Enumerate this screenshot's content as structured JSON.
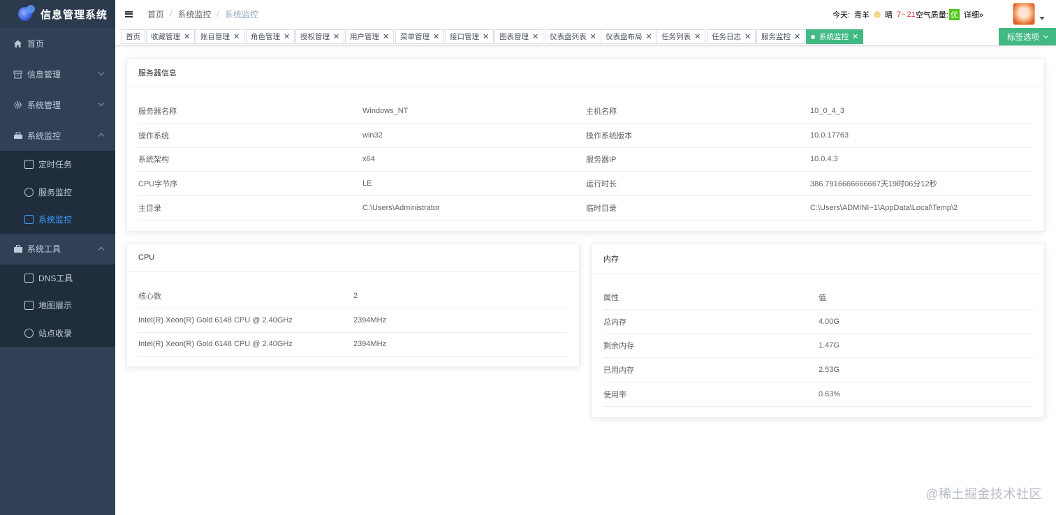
{
  "sidebar": {
    "logo_text": "信息管理系统",
    "items": [
      {
        "label": "首页",
        "icon": "home-icon"
      },
      {
        "label": "信息管理",
        "icon": "archive-icon"
      },
      {
        "label": "系统管理",
        "icon": "gear-icon"
      },
      {
        "label": "系统监控",
        "icon": "monitor-icon"
      }
    ],
    "monitor_sub": [
      {
        "label": "定时任务",
        "icon": "calendar-icon"
      },
      {
        "label": "服务监控",
        "icon": "headset-icon"
      },
      {
        "label": "系统监控",
        "icon": "screen-icon"
      }
    ],
    "tools": {
      "label": "系统工具",
      "icon": "toolbox-icon"
    },
    "tools_sub": [
      {
        "label": "DNS工具",
        "icon": "box-icon"
      },
      {
        "label": "地图展示",
        "icon": "map-icon"
      },
      {
        "label": "站点收录",
        "icon": "location-icon"
      }
    ]
  },
  "header": {
    "breadcrumb": [
      "首页",
      "系统监控",
      "系统监控"
    ],
    "weather": {
      "today": "今天:",
      "city": "青羊",
      "condition": "晴",
      "temp": "7~",
      "temp2": "21",
      "aqi_label": "空气质量:",
      "aqi_value": "优",
      "detail": "详细»"
    }
  },
  "tags": [
    "首页",
    "收藏管理",
    "账目管理",
    "角色管理",
    "授权管理",
    "用户管理",
    "菜单管理",
    "接口管理",
    "图表管理",
    "仪表盘列表",
    "仪表盘布局",
    "任务列表",
    "任务日志",
    "服务监控",
    "系统监控"
  ],
  "tag_options": "标签选项",
  "server": {
    "title": "服务器信息",
    "rows": [
      [
        "服务器名称",
        "Windows_NT",
        "主机名称",
        "10_0_4_3"
      ],
      [
        "操作系统",
        "win32",
        "操作系统版本",
        "10.0.17763"
      ],
      [
        "系统架构",
        "x64",
        "服务器IP",
        "10.0.4.3"
      ],
      [
        "CPU字节序",
        "LE",
        "运行时长",
        "386.7916666666667天19时06分12秒"
      ],
      [
        "主目录",
        "C:\\Users\\Administrator",
        "临时目录",
        "C:\\Users\\ADMINI~1\\AppData\\Local\\Temp\\2"
      ]
    ]
  },
  "cpu": {
    "title": "CPU",
    "rows": [
      [
        "核心数",
        "2"
      ],
      [
        "Intel(R) Xeon(R) Gold 6148 CPU @ 2.40GHz",
        "2394MHz"
      ],
      [
        "Intel(R) Xeon(R) Gold 6148 CPU @ 2.40GHz",
        "2394MHz"
      ]
    ]
  },
  "memory": {
    "title": "内存",
    "rows": [
      [
        "属性",
        "值"
      ],
      [
        "总内存",
        "4.00G"
      ],
      [
        "剩余内存",
        "1.47G"
      ],
      [
        "已用内存",
        "2.53G"
      ],
      [
        "使用率",
        "0.63%"
      ]
    ]
  },
  "watermark": "@稀土掘金技术社区"
}
